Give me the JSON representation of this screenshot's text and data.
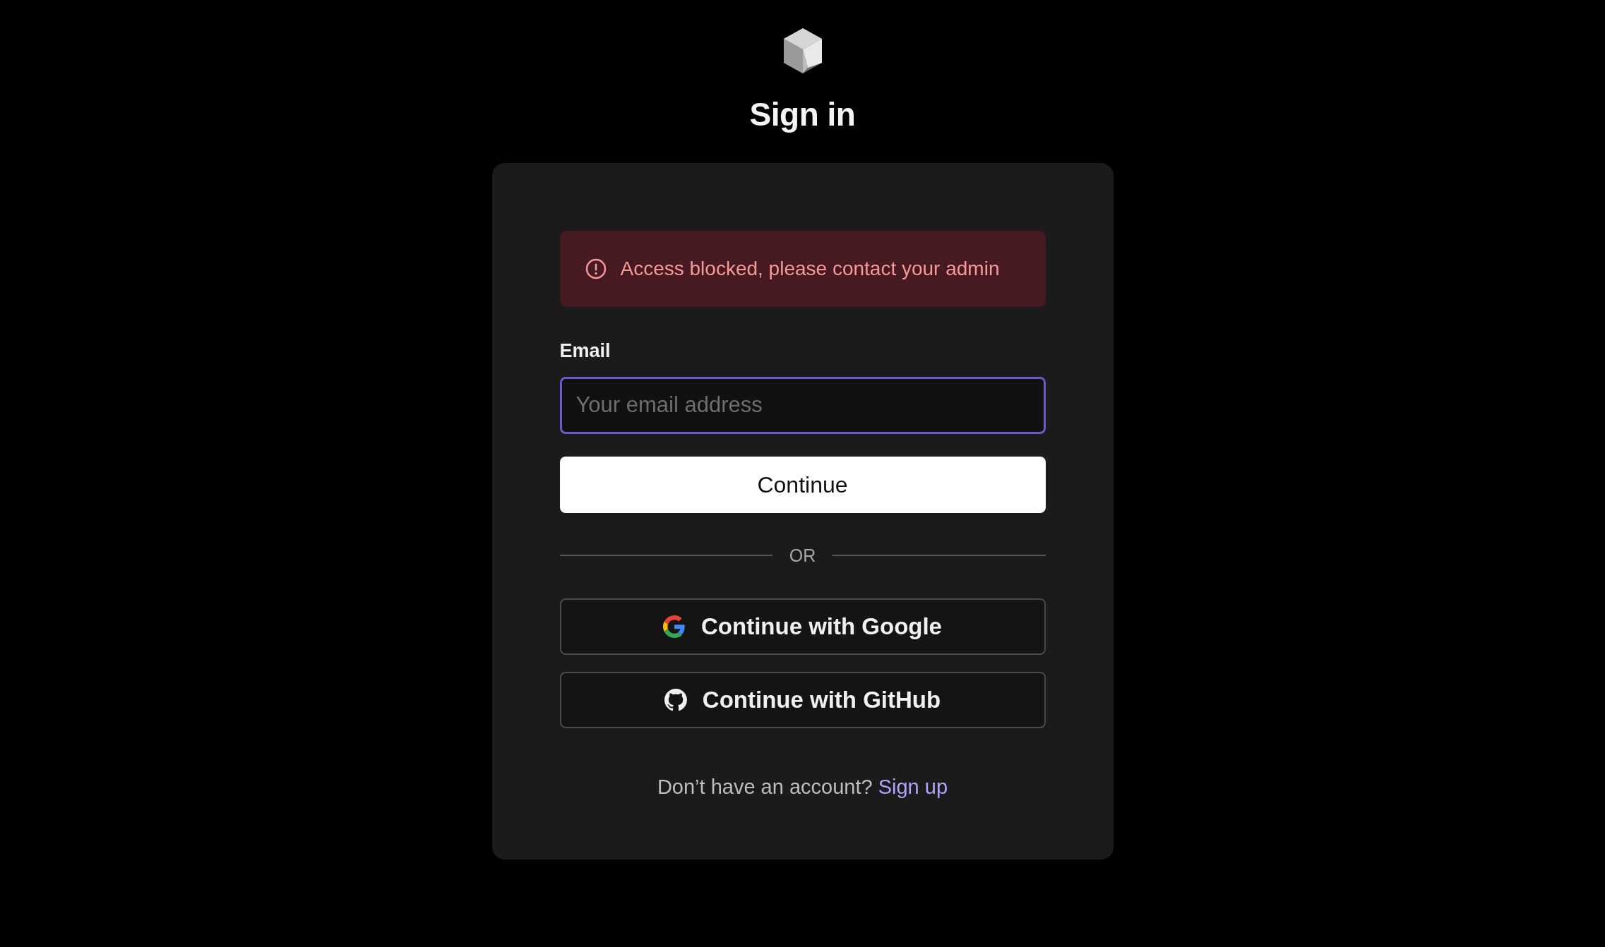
{
  "title": "Sign in",
  "alert": {
    "message": "Access blocked, please contact your admin"
  },
  "email": {
    "label": "Email",
    "placeholder": "Your email address",
    "focused": true
  },
  "continue_button": "Continue",
  "divider": "OR",
  "providers": [
    {
      "kind": "google",
      "label": "Continue with Google"
    },
    {
      "kind": "github",
      "label": "Continue with GitHub"
    }
  ],
  "footer": {
    "text": "Don’t have an account?",
    "link": "Sign up"
  }
}
